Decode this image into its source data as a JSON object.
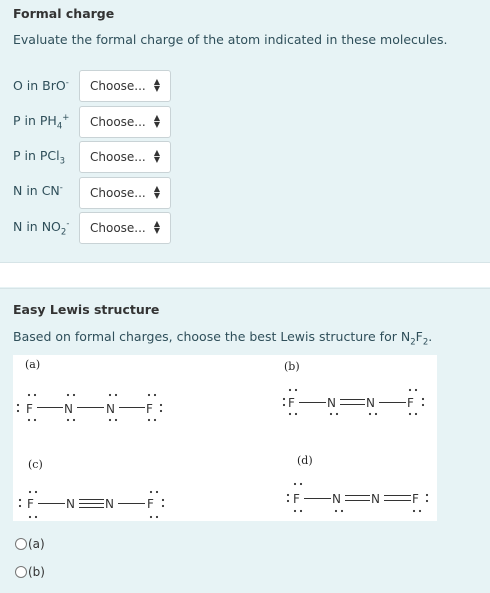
{
  "q1": {
    "title": "Formal charge",
    "prompt": "Evaluate the formal charge of the atom indicated in these molecules.",
    "rows": [
      {
        "pre": "O in BrO",
        "sub": "",
        "sup": "-",
        "select": "Choose..."
      },
      {
        "pre": "P in PH",
        "sub": "4",
        "sup": "+",
        "select": "Choose..."
      },
      {
        "pre": "P in PCl",
        "sub": "3",
        "sup": "",
        "select": "Choose..."
      },
      {
        "pre": "N in CN",
        "sub": "",
        "sup": "-",
        "select": "Choose..."
      },
      {
        "pre": "N in NO",
        "sub": "2",
        "sup": "-",
        "select": "Choose..."
      }
    ]
  },
  "q2": {
    "title": "Easy Lewis structure",
    "prompt_pre": "Based on formal charges, choose the best Lewis structure for N",
    "prompt_sub1": "2",
    "prompt_mid": "F",
    "prompt_sub2": "2",
    "prompt_post": ".",
    "structures": {
      "a": {
        "label": "(a)"
      },
      "b": {
        "label": "(b)"
      },
      "c": {
        "label": "(c)"
      },
      "d": {
        "label": "(d)"
      }
    },
    "options": [
      "(a)",
      "(b)"
    ]
  }
}
